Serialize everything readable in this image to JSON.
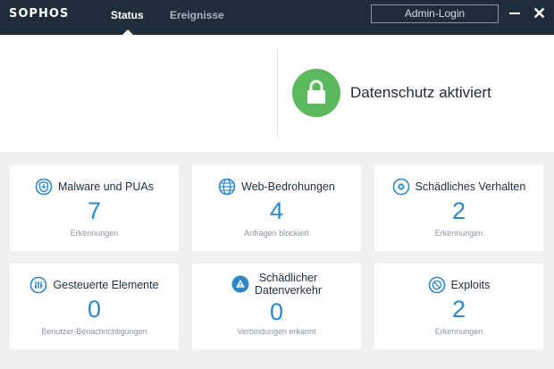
{
  "header": {
    "logo": "SOPHOS",
    "tabs": [
      "Status",
      "Ereignisse"
    ],
    "admin_button": "Admin-Login",
    "close_symbol": "✕"
  },
  "hero": {
    "status_text": "Datenschutz aktiviert",
    "status_color": "#5cb85c",
    "icon": "lock-icon"
  },
  "cards": [
    {
      "title": "Malware und PUAs",
      "value": "7",
      "subtitle": "Erkennungen",
      "icon": "shield-icon"
    },
    {
      "title": "Web-Bedrohungen",
      "value": "4",
      "subtitle": "Anfragen blockiert",
      "icon": "globe-icon"
    },
    {
      "title": "Schädliches Verhalten",
      "value": "2",
      "subtitle": "Erkennungen",
      "icon": "behavior-icon"
    },
    {
      "title": "Gesteuerte Elemente",
      "value": "0",
      "subtitle": "Benutzer-Benachrichtigungen",
      "icon": "controlled-items-icon"
    },
    {
      "title_line1": "Schädlicher",
      "title_line2": "Datenverkehr",
      "value": "0",
      "subtitle": "Verbindungen erkannt",
      "icon": "warning-icon"
    },
    {
      "title": "Exploits",
      "value": "2",
      "subtitle": "Erkennungen",
      "icon": "exploit-icon"
    }
  ],
  "colors": {
    "titlebar": "#1f2d3a",
    "accent_blue": "#2f87c8",
    "background": "#eef0f2"
  }
}
